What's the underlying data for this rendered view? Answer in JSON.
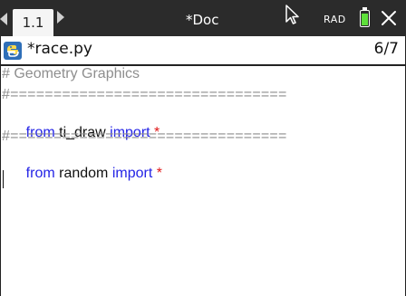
{
  "topbar": {
    "tab_label": "1.1",
    "document_title": "*Doc",
    "angle_mode": "RAD",
    "icons": {
      "nav_left": "triangle-left-icon",
      "nav_right": "triangle-right-icon",
      "pointer": "mouse-pointer-icon",
      "battery": "battery-icon",
      "close": "close-icon"
    },
    "battery_color": "#5ee03a",
    "background_color": "#2b2b2b"
  },
  "filebar": {
    "filename": "*race.py",
    "line_counter": "6/7",
    "icon": "python-file-icon"
  },
  "editor": {
    "line1": {
      "text": "# Geometry Graphics"
    },
    "line2": {
      "text": "#================================"
    },
    "line3": {
      "from": "from",
      "module": " ti_draw ",
      "import": "import",
      "star": " *"
    },
    "line4": {
      "text": "#================================"
    },
    "line5": {
      "from": "from",
      "module": " random ",
      "import": "import",
      "star": " *"
    },
    "colors": {
      "comment": "#8e8e8e",
      "keyword": "#2424e6",
      "operator": "#e01818"
    }
  }
}
